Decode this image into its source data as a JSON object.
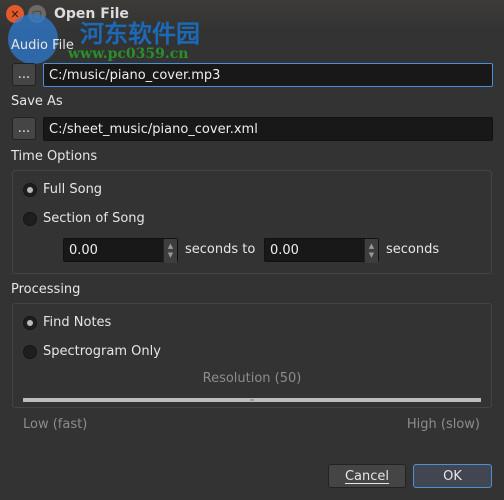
{
  "window": {
    "title": "Open File",
    "watermark": {
      "text": "河东软件园",
      "url": "www.pc0359.cn"
    }
  },
  "audio_file": {
    "label": "Audio File",
    "browse": "...",
    "value": "C:/music/piano_cover.mp3"
  },
  "save_as": {
    "label": "Save As",
    "browse": "...",
    "value": "C:/sheet_music/piano_cover.xml"
  },
  "time_options": {
    "label": "Time Options",
    "full_song": "Full Song",
    "section": "Section of Song",
    "selected": "full_song",
    "start": "0.00",
    "seconds_to": "seconds to",
    "end": "0.00",
    "seconds": "seconds"
  },
  "processing": {
    "label": "Processing",
    "find_notes": "Find Notes",
    "spectrogram": "Spectrogram Only",
    "selected": "find_notes",
    "resolution_label": "Resolution (50)",
    "resolution_value": 50,
    "low": "Low (fast)",
    "high": "High (slow)"
  },
  "buttons": {
    "cancel": "Cancel",
    "ok": "OK"
  },
  "colors": {
    "accent": "#4a90d9",
    "close": "#e05a2b"
  }
}
